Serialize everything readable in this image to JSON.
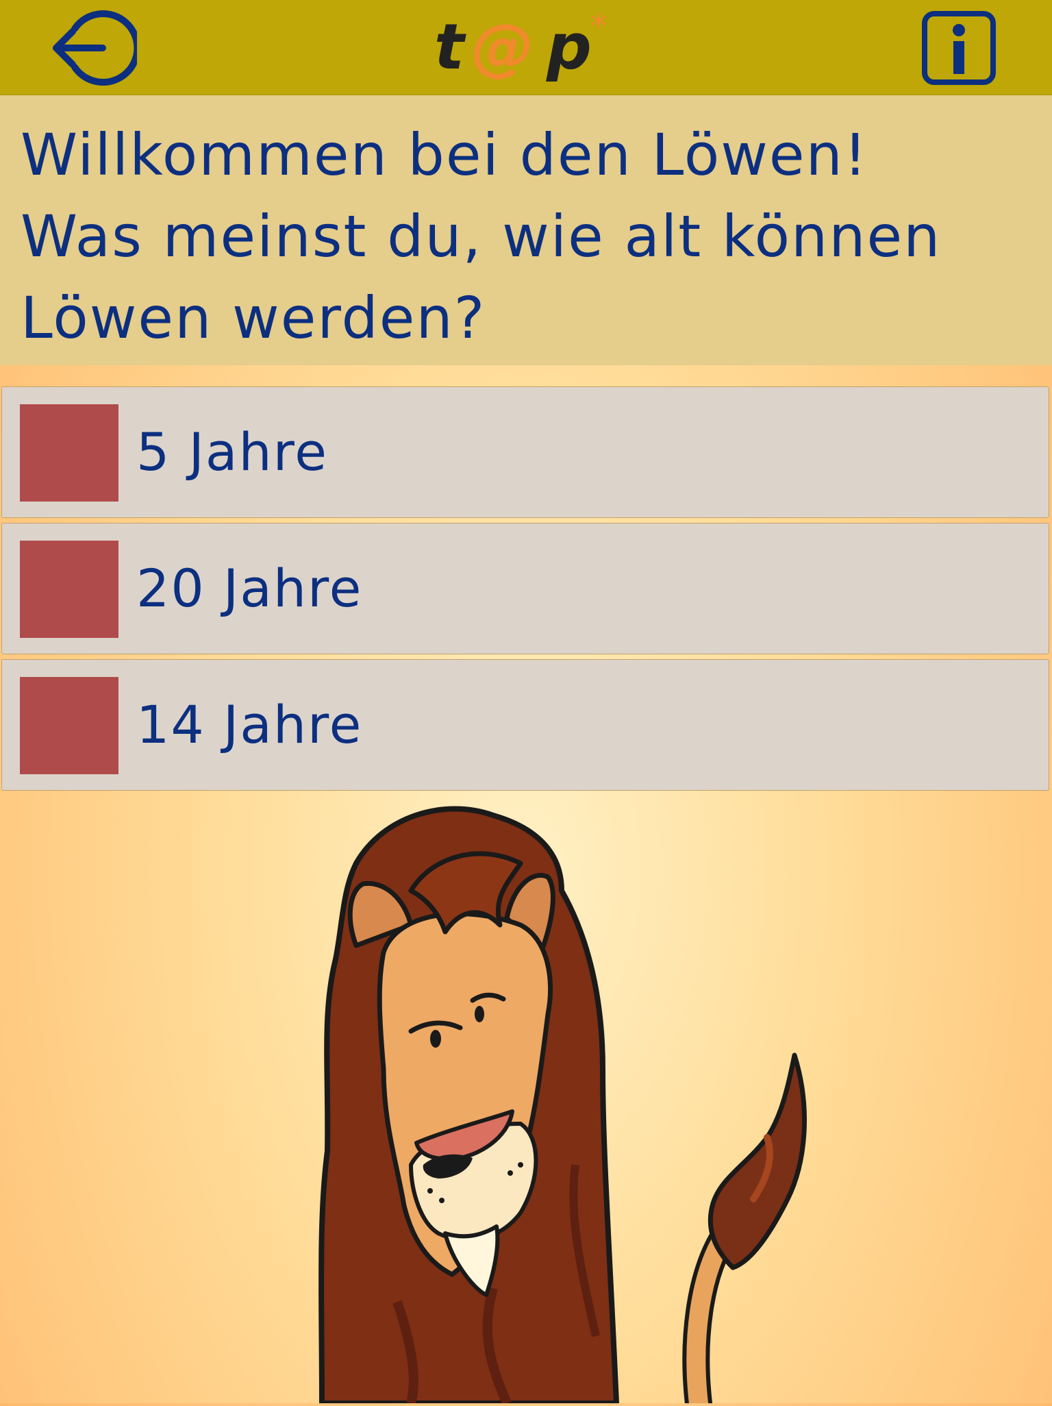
{
  "header": {
    "back_icon": "exit-arrow-icon",
    "info_icon": "info-icon",
    "logo": {
      "text": "t@p*",
      "colors": {
        "letters": "#222222",
        "at_sign": "#f08a2c",
        "asterisk": "#f08a2c"
      }
    },
    "colors": {
      "background": "#bea706",
      "icon": "#0c2f80"
    }
  },
  "question": {
    "line1": "Willkommen bei den Löwen!",
    "line2": "Was meinst du, wie alt können",
    "line3": "Löwen werden?"
  },
  "answers": [
    {
      "label": "5 Jahre"
    },
    {
      "label": "20 Jahre"
    },
    {
      "label": "14 Jahre"
    }
  ],
  "illustration": {
    "icon": "lion-illustration"
  },
  "colors": {
    "text": "#0c2f80",
    "question_background": "#e5cd8b",
    "answer_background": "#dcd4cb",
    "checkbox": "#b04b4b",
    "page_background": "#ffd48a"
  }
}
